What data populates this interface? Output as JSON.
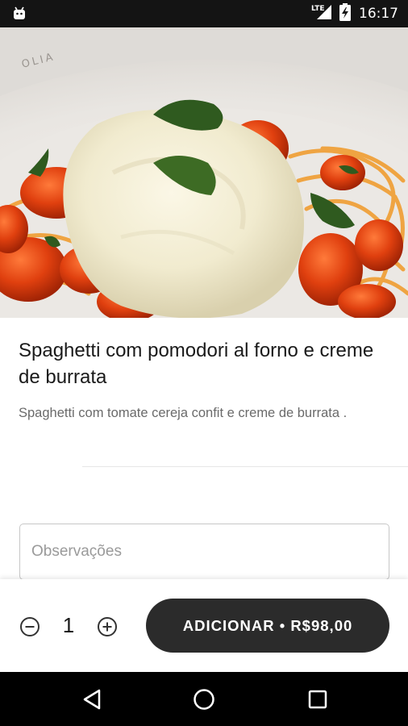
{
  "status_bar": {
    "network": "LTE",
    "time": "16:17"
  },
  "product": {
    "image_name": "spaghetti-burrata-photo",
    "title": "Spaghetti com pomodori al forno e creme de burrata",
    "description": "Spaghetti com tomate cereja confit e creme de burrata ."
  },
  "observations": {
    "placeholder": "Observações",
    "value": ""
  },
  "order": {
    "quantity": "1",
    "add_button_label": "ADICIONAR • R$98,00"
  },
  "colors": {
    "button_bg": "#2b2b2b",
    "status_bar_bg": "#141414",
    "nav_bar_bg": "#000000"
  }
}
